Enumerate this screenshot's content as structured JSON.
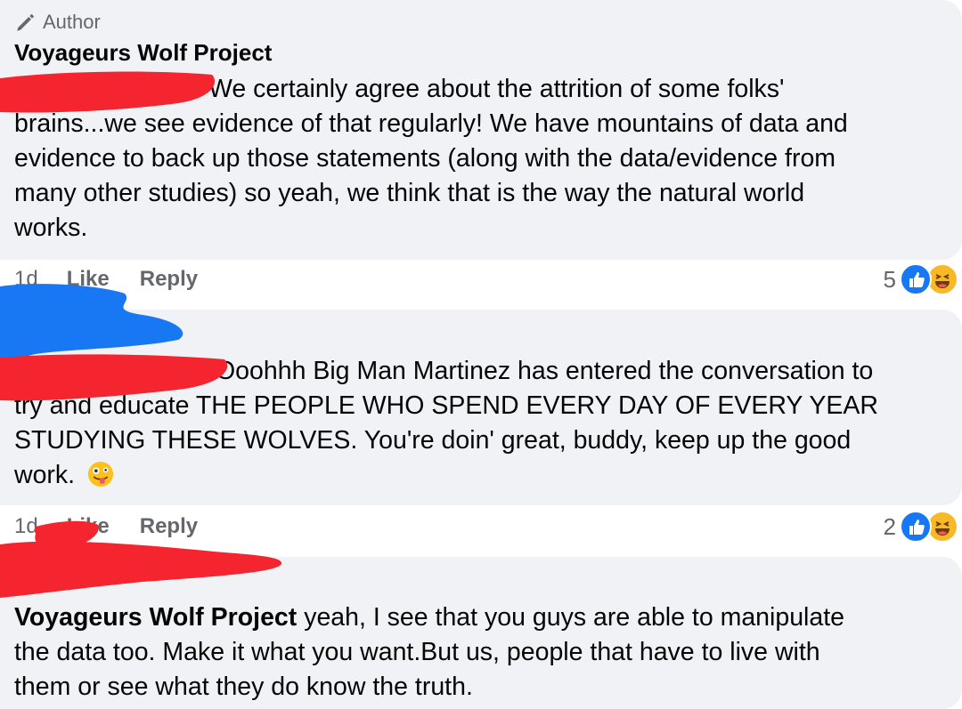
{
  "colors": {
    "bubble_bg": "#f0f2f5",
    "meta_text": "#65676b",
    "like_blue": "#1877f2",
    "haha_yellow": "#f7b928",
    "redaction_red": "#f5252f",
    "redaction_blue": "#1877f2"
  },
  "comment1": {
    "badge_icon": "pen-icon",
    "badge": "Author",
    "author": "Voyageurs Wolf Project",
    "lines": [
      "We certainly agree about the attrition of some folks'",
      "brains...we see evidence of that regularly! We have mountains of data and",
      "evidence to back up those statements (along with the data/evidence from",
      "many other studies) so yeah, we think that is the way the natural world",
      "works."
    ],
    "time": "1d",
    "like": "Like",
    "reply": "Reply",
    "reaction_count": "5",
    "reactions": [
      "like-reaction-icon",
      "haha-reaction-icon"
    ]
  },
  "comment2": {
    "lines": [
      "Ooohhh Big Man Martinez has entered the conversation to",
      "try and educate THE PEOPLE WHO SPEND EVERY DAY OF EVERY YEAR",
      "STUDYING THESE WOLVES. You're doin' great, buddy, keep up the good",
      "work."
    ],
    "emoji": "zany-face-emoji",
    "time": "1d",
    "like": "Like",
    "reply": "Reply",
    "reaction_count": "2",
    "reactions": [
      "like-reaction-icon",
      "haha-reaction-icon"
    ]
  },
  "comment3": {
    "mention": "Voyageurs Wolf Project",
    "line1_rest": " yeah, I see that you guys are able to manipulate",
    "lines": [
      "the data too. Make it what you want.But us, people that have to live with",
      "them or see what they do know the truth."
    ]
  }
}
